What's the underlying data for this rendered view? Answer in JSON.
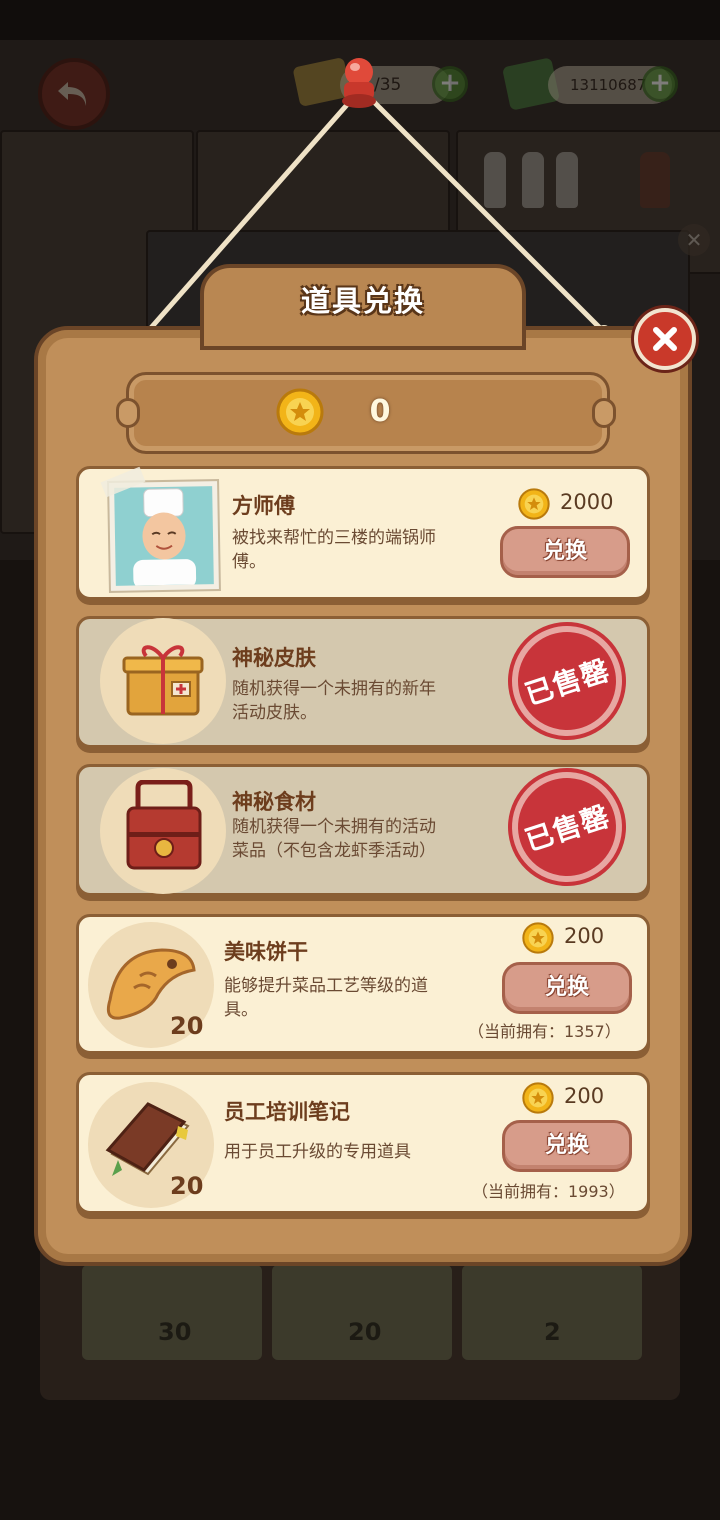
{
  "hud": {
    "back_icon": "undo-arrow-icon",
    "tickets_value": "/35",
    "cash_value": "13110687",
    "plus_icon": "plus-icon"
  },
  "dialog": {
    "title": "道具兑换",
    "coin_balance": "0",
    "close_icon": "close-icon"
  },
  "items": [
    {
      "title": "方师傅",
      "desc": "被找来帮忙的三楼的端锅师傅。",
      "price": "2000",
      "button": "兑换",
      "icon": "chef-portrait-icon",
      "status": "available"
    },
    {
      "title": "神秘皮肤",
      "desc": "随机获得一个未拥有的新年活动皮肤。",
      "stamp": "已售罄",
      "icon": "gift-box-icon",
      "status": "sold_out"
    },
    {
      "title": "神秘食材",
      "desc": "随机获得一个未拥有的活动菜品（不包含龙虾季活动）",
      "stamp": "已售罄",
      "icon": "lunch-box-icon",
      "status": "sold_out"
    },
    {
      "title": "美味饼干",
      "desc": "能够提升菜品工艺等级的道具。",
      "price": "200",
      "button": "兑换",
      "qty": "20",
      "owned": "（当前拥有：1357）",
      "icon": "fish-cookie-icon",
      "status": "available"
    },
    {
      "title": "员工培训笔记",
      "desc": "用于员工升级的专用道具",
      "price": "200",
      "button": "兑换",
      "qty": "20",
      "owned": "（当前拥有：1993）",
      "icon": "notebook-icon",
      "status": "available"
    }
  ],
  "background": {
    "bottom_counts": [
      "30",
      "20",
      "2"
    ]
  },
  "colors": {
    "board": "#c08f5a",
    "card": "#fbf0d4",
    "button": "#d79c8a",
    "stamp": "#c8343a",
    "close": "#c9392a"
  }
}
